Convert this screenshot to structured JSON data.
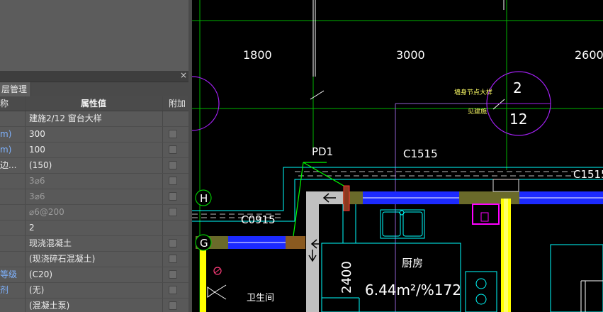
{
  "panel": {
    "close_glyph": "×",
    "tab_label": "层管理",
    "headers": {
      "name": "称",
      "value": "属性值",
      "extra": "附加"
    },
    "rows": [
      {
        "name": "",
        "value": "建施2/12 窗台大样",
        "name_blue": false,
        "value_gray": false,
        "checkbox": false
      },
      {
        "name": "m)",
        "value": "300",
        "name_blue": true,
        "value_gray": false,
        "checkbox": true
      },
      {
        "name": "m)",
        "value": "100",
        "name_blue": true,
        "value_gray": false,
        "checkbox": true
      },
      {
        "name": "边...",
        "value": "(150)",
        "name_blue": false,
        "value_gray": false,
        "checkbox": true
      },
      {
        "name": "",
        "value": "3⌀6",
        "name_blue": false,
        "value_gray": true,
        "checkbox": true
      },
      {
        "name": "",
        "value": "3⌀6",
        "name_blue": false,
        "value_gray": true,
        "checkbox": true
      },
      {
        "name": "",
        "value": "⌀6@200",
        "name_blue": false,
        "value_gray": true,
        "checkbox": true
      },
      {
        "name": "",
        "value": "2",
        "name_blue": false,
        "value_gray": false,
        "checkbox": false
      },
      {
        "name": "",
        "value": "现浇混凝土",
        "name_blue": false,
        "value_gray": false,
        "checkbox": true
      },
      {
        "name": "",
        "value": "(现浇碎石混凝土)",
        "name_blue": false,
        "value_gray": false,
        "checkbox": true
      },
      {
        "name": "等级",
        "value": "(C20)",
        "name_blue": true,
        "value_gray": false,
        "checkbox": true
      },
      {
        "name": "剂",
        "value": "(无)",
        "name_blue": true,
        "value_gray": false,
        "checkbox": true
      },
      {
        "name": "",
        "value": "(混凝土泵)",
        "name_blue": false,
        "value_gray": false,
        "checkbox": true
      }
    ]
  },
  "drawing": {
    "dim_1800": "1800",
    "dim_3000": "3000",
    "dim_2600": "2600",
    "callout_top": "2",
    "callout_bottom": "12",
    "note_1": "墙身节点大样",
    "note_2": "见建施",
    "label_pd1": "PD1",
    "label_c1515": "C1515",
    "label_c1515_right": "C1515",
    "label_c0915": "C0915",
    "axis_h": "H",
    "axis_g": "G",
    "dim_2400": "2400",
    "room_name": "厨房",
    "room_area": "6.44m²/%172",
    "room_bath": "卫生间"
  },
  "colors": {
    "background": "#000000",
    "axis_green": "#00c800",
    "wall_cyan": "#00ffff",
    "window_blue": "#1e3cff",
    "column_yellow": "#ffff00",
    "callout_purple": "#a020f0",
    "panel_gray": "#5a5a5a"
  }
}
